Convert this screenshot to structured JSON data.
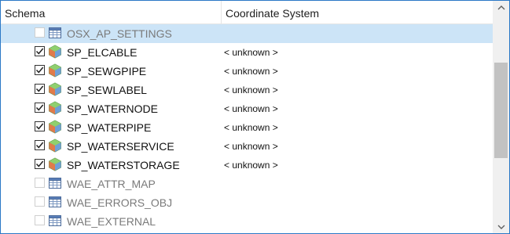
{
  "header": {
    "schema_label": "Schema",
    "coord_label": "Coordinate System"
  },
  "rows": [
    {
      "name": "OSX_AP_SETTINGS",
      "coord": "",
      "checked": false,
      "enabled": false,
      "icon": "table-icon",
      "selected": true
    },
    {
      "name": "SP_ELCABLE",
      "coord": "< unknown >",
      "checked": true,
      "enabled": true,
      "icon": "feature-class-icon",
      "selected": false
    },
    {
      "name": "SP_SEWGPIPE",
      "coord": "< unknown >",
      "checked": true,
      "enabled": true,
      "icon": "feature-class-icon",
      "selected": false
    },
    {
      "name": "SP_SEWLABEL",
      "coord": "< unknown >",
      "checked": true,
      "enabled": true,
      "icon": "feature-class-icon",
      "selected": false
    },
    {
      "name": "SP_WATERNODE",
      "coord": "< unknown >",
      "checked": true,
      "enabled": true,
      "icon": "feature-class-icon",
      "selected": false
    },
    {
      "name": "SP_WATERPIPE",
      "coord": "< unknown >",
      "checked": true,
      "enabled": true,
      "icon": "feature-class-icon",
      "selected": false
    },
    {
      "name": "SP_WATERSERVICE",
      "coord": "< unknown >",
      "checked": true,
      "enabled": true,
      "icon": "feature-class-icon",
      "selected": false
    },
    {
      "name": "SP_WATERSTORAGE",
      "coord": "< unknown >",
      "checked": true,
      "enabled": true,
      "icon": "feature-class-icon",
      "selected": false
    },
    {
      "name": "WAE_ATTR_MAP",
      "coord": "",
      "checked": false,
      "enabled": false,
      "icon": "table-icon",
      "selected": false
    },
    {
      "name": "WAE_ERRORS_OBJ",
      "coord": "",
      "checked": false,
      "enabled": false,
      "icon": "table-icon",
      "selected": false
    },
    {
      "name": "WAE_EXTERNAL",
      "coord": "",
      "checked": false,
      "enabled": false,
      "icon": "table-icon",
      "selected": false
    }
  ],
  "colors": {
    "selection": "#cce4f7",
    "border": "#2b78c6",
    "disabled_text": "#7a7a7a"
  }
}
